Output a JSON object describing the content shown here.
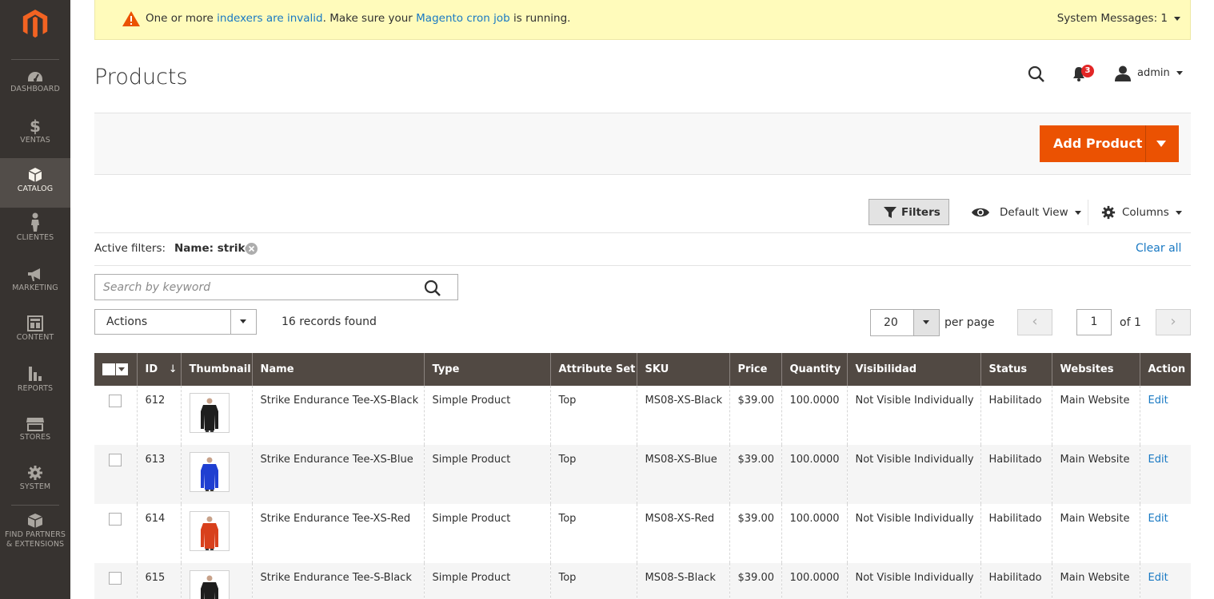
{
  "sidebar": {
    "items": [
      {
        "label": "DASHBOARD",
        "icon": "dashboard-icon"
      },
      {
        "label": "VENTAS",
        "icon": "dollar-icon"
      },
      {
        "label": "CATALOG",
        "icon": "box-icon"
      },
      {
        "label": "CLIENTES",
        "icon": "person-icon"
      },
      {
        "label": "MARKETING",
        "icon": "megaphone-icon"
      },
      {
        "label": "CONTENT",
        "icon": "layout-icon"
      },
      {
        "label": "REPORTS",
        "icon": "bar-chart-icon"
      },
      {
        "label": "STORES",
        "icon": "store-icon"
      },
      {
        "label": "SYSTEM",
        "icon": "gear-icon"
      },
      {
        "label": "FIND PARTNERS & EXTENSIONS",
        "icon": "partners-icon"
      }
    ],
    "active": "CATALOG"
  },
  "message": {
    "text_1": "One or more ",
    "link_1": "indexers are invalid",
    "text_2": ". Make sure your ",
    "link_2": "Magento cron job",
    "text_3": " is running.",
    "system_messages": "System Messages: 1"
  },
  "header": {
    "title": "Products",
    "notification_count": "3",
    "user": "admin"
  },
  "toolbar": {
    "add_product": "Add Product",
    "filters": "Filters",
    "default_view": "Default View",
    "columns": "Columns"
  },
  "active_filters": {
    "label": "Active filters:",
    "filter": "Name: strike",
    "clear_all": "Clear all"
  },
  "search": {
    "placeholder": "Search by keyword"
  },
  "grid": {
    "actions_label": "Actions",
    "records_found": "16 records found",
    "per_page_value": "20",
    "per_page_label": "per page",
    "page": "1",
    "of_pages": "of 1",
    "columns": [
      "ID",
      "Thumbnail",
      "Name",
      "Type",
      "Attribute Set",
      "SKU",
      "Price",
      "Quantity",
      "Visibilidad",
      "Status",
      "Websites",
      "Action"
    ],
    "sort_indicator": "↓",
    "rows": [
      {
        "id": "612",
        "name": "Strike Endurance Tee-XS-Black",
        "type": "Simple Product",
        "attribute_set": "Top",
        "sku": "MS08-XS-Black",
        "price": "$39.00",
        "quantity": "100.0000",
        "visibility": "Not Visible Individually",
        "status": "Habilitado",
        "websites": "Main Website",
        "action": "Edit",
        "thumb_color": "#1e1e1e"
      },
      {
        "id": "613",
        "name": "Strike Endurance Tee-XS-Blue",
        "type": "Simple Product",
        "attribute_set": "Top",
        "sku": "MS08-XS-Blue",
        "price": "$39.00",
        "quantity": "100.0000",
        "visibility": "Not Visible Individually",
        "status": "Habilitado",
        "websites": "Main Website",
        "action": "Edit",
        "thumb_color": "#1f3fd1"
      },
      {
        "id": "614",
        "name": "Strike Endurance Tee-XS-Red",
        "type": "Simple Product",
        "attribute_set": "Top",
        "sku": "MS08-XS-Red",
        "price": "$39.00",
        "quantity": "100.0000",
        "visibility": "Not Visible Individually",
        "status": "Habilitado",
        "websites": "Main Website",
        "action": "Edit",
        "thumb_color": "#d8401c"
      },
      {
        "id": "615",
        "name": "Strike Endurance Tee-S-Black",
        "type": "Simple Product",
        "attribute_set": "Top",
        "sku": "MS08-S-Black",
        "price": "$39.00",
        "quantity": "100.0000",
        "visibility": "Not Visible Individually",
        "status": "Habilitado",
        "websites": "Main Website",
        "action": "Edit",
        "thumb_color": "#1e1e1e"
      }
    ]
  },
  "colors": {
    "accent": "#eb5202",
    "sidebar": "#373330",
    "grid_header": "#514943",
    "link": "#1979c3",
    "message_bg": "#fffbbb"
  }
}
